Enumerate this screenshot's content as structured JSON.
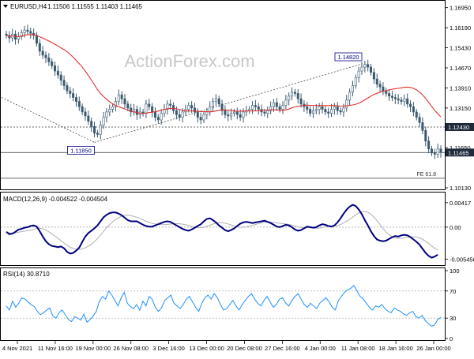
{
  "chart_data": [
    {
      "type": "candlestick",
      "panel": "price",
      "title": "EURUSD,H4",
      "ohlc": "1.11506 1.11555 1.11403 1.11465",
      "watermark": "ActionForex.com",
      "ylim": [
        1.1013,
        1.1712
      ],
      "yticks": [
        "1.16950",
        "1.16190",
        "1.15430",
        "1.14670",
        "1.13910",
        "1.13150",
        "1.12390",
        "1.11650",
        "1.10130"
      ],
      "ytick_values": [
        1.1695,
        1.1619,
        1.1543,
        1.1467,
        1.1391,
        1.1315,
        1.1239,
        1.1165,
        1.1013
      ],
      "price_tags": [
        {
          "label": "1.12430",
          "value": 1.1243,
          "style": "dark"
        },
        {
          "label": "1.11465",
          "value": 1.11465,
          "style": "dark"
        }
      ],
      "levels": [
        {
          "value": 1.1243,
          "style": "dotted"
        },
        {
          "value": 1.11465,
          "style": "solid"
        },
        {
          "value": 1.1049,
          "style": "solid",
          "label": "FE 61.8"
        }
      ],
      "annotations": [
        {
          "label": "1.11850",
          "value": 1.1185,
          "index": 29
        },
        {
          "label": "1.14820",
          "value": 1.1482,
          "index": 117
        }
      ],
      "close": [
        1.159,
        1.158,
        1.1595,
        1.1575,
        1.1585,
        1.16,
        1.161,
        1.1605,
        1.1598,
        1.159,
        1.156,
        1.153,
        1.1515,
        1.1505,
        1.149,
        1.1475,
        1.1455,
        1.144,
        1.142,
        1.14,
        1.138,
        1.137,
        1.1355,
        1.134,
        1.132,
        1.13,
        1.1285,
        1.1265,
        1.1245,
        1.122,
        1.1215,
        1.125,
        1.128,
        1.13,
        1.131,
        1.132,
        1.134,
        1.1365,
        1.135,
        1.133,
        1.1315,
        1.13,
        1.131,
        1.129,
        1.13,
        1.1295,
        1.133,
        1.132,
        1.13,
        1.128,
        1.127,
        1.1295,
        1.131,
        1.133,
        1.1325,
        1.1305,
        1.129,
        1.128,
        1.13,
        1.131,
        1.1325,
        1.1315,
        1.13,
        1.128,
        1.127,
        1.129,
        1.13,
        1.132,
        1.134,
        1.135,
        1.133,
        1.1305,
        1.129,
        1.1285,
        1.1295,
        1.13,
        1.129,
        1.128,
        1.13,
        1.1305,
        1.131,
        1.1325,
        1.132,
        1.131,
        1.13,
        1.1295,
        1.1305,
        1.132,
        1.1335,
        1.132,
        1.131,
        1.1325,
        1.1345,
        1.136,
        1.1375,
        1.137,
        1.135,
        1.133,
        1.132,
        1.131,
        1.1295,
        1.1305,
        1.131,
        1.132,
        1.131,
        1.13,
        1.1295,
        1.131,
        1.132,
        1.1305,
        1.13,
        1.1315,
        1.1345,
        1.1375,
        1.14,
        1.143,
        1.1455,
        1.147,
        1.148,
        1.147,
        1.145,
        1.1425,
        1.1405,
        1.1395,
        1.138,
        1.137,
        1.136,
        1.1355,
        1.135,
        1.1345,
        1.134,
        1.135,
        1.133,
        1.132,
        1.13,
        1.128,
        1.126,
        1.123,
        1.119,
        1.116,
        1.1145,
        1.114,
        1.116,
        1.1147
      ],
      "ma_period": 21
    },
    {
      "type": "line",
      "panel": "macd",
      "title": "MACD(12,26,9) -0.004522 -0.004504",
      "ylim": [
        -0.0062,
        0.0055
      ],
      "yticks": [
        "0.00417",
        "0.00",
        "-0.005456"
      ],
      "ytick_values": [
        0.00417,
        0.0,
        -0.005456
      ],
      "series": [
        {
          "name": "MACD",
          "color": "#000080",
          "values": [
            -0.0008,
            -0.0012,
            -0.0011,
            -0.0008,
            -0.0004,
            -0.0003,
            -0.0001,
            0.0,
            0.0002,
            0.0003,
            0.0001,
            -0.0007,
            -0.0016,
            -0.0024,
            -0.0029,
            -0.0032,
            -0.0033,
            -0.0034,
            -0.0033,
            -0.0036,
            -0.0042,
            -0.0045,
            -0.0044,
            -0.004,
            -0.0035,
            -0.0025,
            -0.0016,
            -0.001,
            -0.0006,
            -0.0002,
            0.0003,
            0.001,
            0.0017,
            0.0021,
            0.0024,
            0.0025,
            0.0025,
            0.0023,
            0.002,
            0.0016,
            0.0012,
            0.001,
            0.001,
            0.001,
            0.0007,
            0.0004,
            0.0002,
            0.0001,
            0.0001,
            0.0003,
            0.0005,
            0.0007,
            0.0009,
            0.001,
            0.0009,
            0.0006,
            0.0003,
            0.0,
            -0.0003,
            -0.0005,
            -0.0006,
            -0.0004,
            -0.0001,
            0.0002,
            0.0005,
            0.001,
            0.0014,
            0.0015,
            0.0012,
            0.0008,
            0.0003,
            -0.0001,
            -0.0005,
            -0.0007,
            -0.0005,
            -0.0002,
            0.0002,
            0.0006,
            0.0008,
            0.0009,
            0.0008,
            0.0007,
            0.0008,
            0.0009,
            0.001,
            0.0011,
            0.0009,
            0.0007,
            0.0004,
            0.0001,
            0.0,
            0.0002,
            0.0004,
            0.0003,
            0.0,
            -0.0004,
            -0.0006,
            -0.0005,
            -0.0002,
            0.0001,
            0.0,
            -0.0001,
            0.0,
            0.0003,
            0.0005,
            0.0004,
            0.0002,
            0.0001,
            0.0003,
            0.0008,
            0.0015,
            0.0023,
            0.003,
            0.0035,
            0.0038,
            0.0036,
            0.003,
            0.0022,
            0.0012,
            0.0003,
            -0.0007,
            -0.0015,
            -0.0021,
            -0.0023,
            -0.0024,
            -0.0023,
            -0.002,
            -0.0017,
            -0.0015,
            -0.0016,
            -0.0014,
            -0.0013,
            -0.0014,
            -0.0017,
            -0.0021,
            -0.0025,
            -0.003,
            -0.0037,
            -0.0044,
            -0.0049,
            -0.0052,
            -0.005,
            -0.0047
          ]
        },
        {
          "name": "Signal",
          "color": "#b0b0b0",
          "values": []
        }
      ]
    },
    {
      "type": "line",
      "panel": "rsi",
      "title": "RSI(14) 30.8710",
      "ylim": [
        0,
        100
      ],
      "yticks": [
        "100",
        "70",
        "30",
        "0"
      ],
      "ytick_values": [
        100,
        70,
        30,
        0
      ],
      "levels": [
        70,
        30
      ],
      "series": [
        {
          "name": "RSI",
          "color": "#1e90ff",
          "values": [
            48,
            42,
            55,
            46,
            52,
            60,
            58,
            54,
            50,
            47,
            40,
            35,
            38,
            42,
            45,
            33,
            30,
            38,
            42,
            35,
            28,
            25,
            32,
            30,
            27,
            36,
            24,
            28,
            33,
            40,
            55,
            62,
            58,
            70,
            64,
            56,
            48,
            60,
            68,
            52,
            47,
            44,
            50,
            42,
            55,
            48,
            62,
            58,
            46,
            40,
            45,
            56,
            60,
            64,
            52,
            48,
            44,
            50,
            58,
            62,
            54,
            46,
            40,
            52,
            60,
            64,
            58,
            66,
            60,
            50,
            42,
            44,
            50,
            56,
            48,
            42,
            50,
            56,
            62,
            66,
            58,
            52,
            48,
            56,
            62,
            54,
            46,
            50,
            58,
            60,
            52,
            48,
            56,
            62,
            66,
            58,
            50,
            46,
            52,
            48,
            44,
            52,
            56,
            60,
            54,
            46,
            42,
            56,
            62,
            68,
            72,
            74,
            78,
            70,
            62,
            58,
            52,
            46,
            42,
            48,
            46,
            50,
            44,
            40,
            38,
            45,
            42,
            40,
            36,
            34,
            38,
            40,
            32,
            30,
            34,
            26,
            22,
            18,
            20,
            28,
            31
          ]
        }
      ]
    }
  ],
  "x_labels": [
    "4 Nov 2021",
    "11 Nov 16:00",
    "19 Nov 00:00",
    "26 Nov 08:00",
    "3 Dec 16:00",
    "13 Dec 00:00",
    "20 Dec 08:00",
    "27 Dec 16:00",
    "4 Jan 00:00",
    "11 Jan 08:00",
    "18 Jan 16:00",
    "26 Jan 00:00"
  ],
  "colors": {
    "candle": "#3c5a6e",
    "ma": "#e03030",
    "grid": "#9a9a9a",
    "axis_text": "#000000",
    "tag_bg": "#1e2a3a",
    "tag_text": "#ffffff",
    "annotation_border": "#000080",
    "watermark": "#c8c8c8"
  }
}
